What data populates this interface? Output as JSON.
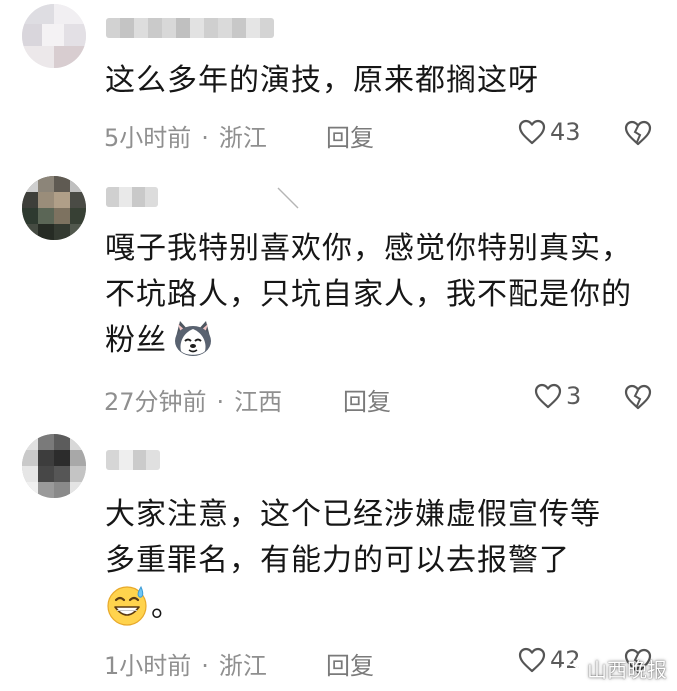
{
  "comments": [
    {
      "text_lines": [
        "这么多年的演技，原来都搁这呀"
      ],
      "time": "5小时前",
      "location": "浙江",
      "reply_label": "回复",
      "likes": "43",
      "dislike_icon": "broken-heart-icon"
    },
    {
      "text_lines": [
        "嘎子我特别喜欢你，感觉你特别真实，",
        "不坑路人，只坑自家人，我不配是你的",
        "粉丝"
      ],
      "emoji": "husky-emoji-icon",
      "time": "27分钟前",
      "location": "江西",
      "reply_label": "回复",
      "likes": "3",
      "dislike_icon": "broken-heart-icon"
    },
    {
      "text_lines": [
        "大家注意，这个已经涉嫌虚假宣传等",
        "多重罪名，有能力的可以去报警了",
        "。"
      ],
      "emoji": "sweat-smile-emoji-icon",
      "time": "1小时前",
      "location": "浙江",
      "reply_label": "回复",
      "likes": "42",
      "dislike_icon": "broken-heart-icon"
    }
  ],
  "separator": "·",
  "watermark": {
    "text": "山西晚报",
    "icon": "weibo-logo-icon"
  },
  "colors": {
    "text": "#161616",
    "meta": "#8f8f8f",
    "icon": "#555555"
  }
}
